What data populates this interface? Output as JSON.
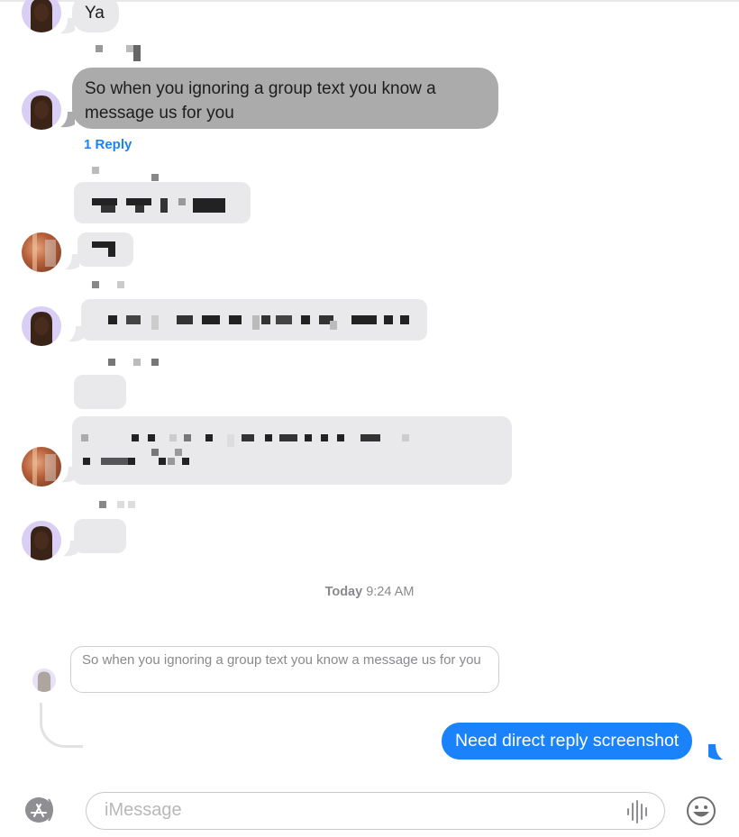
{
  "conversation": {
    "messages": [
      {
        "sender": "contact-memoji",
        "text": "Ya",
        "style": "incoming"
      },
      {
        "sender": "contact-memoji",
        "text": "So when you ignoring a group text you know a message us for you",
        "style": "incoming-selected",
        "reply_count_label": "1 Reply"
      },
      {
        "sender": "redacted",
        "text": "",
        "style": "incoming-redacted"
      },
      {
        "sender": "contact-photo",
        "text": "",
        "style": "incoming-redacted"
      },
      {
        "sender": "contact-memoji",
        "text": "",
        "style": "incoming-redacted"
      },
      {
        "sender": "redacted",
        "text": "",
        "style": "incoming-redacted"
      },
      {
        "sender": "contact-photo",
        "text": "",
        "style": "incoming-redacted"
      },
      {
        "sender": "contact-memoji",
        "text": "",
        "style": "incoming-redacted"
      }
    ],
    "timestamp": {
      "day": "Today",
      "time": "9:24 AM"
    },
    "inline_reply": {
      "quoted_text": "So when you ignoring a group text you know a message us for you",
      "reply_text": "Need direct reply screenshot"
    }
  },
  "composer": {
    "placeholder": "iMessage",
    "value": "",
    "apps_icon": "app-store-icon",
    "audio_icon": "waveform-icon",
    "emoji_icon": "smiley-icon"
  },
  "colors": {
    "accent_blue": "#1a82fb",
    "incoming_bubble": "#e9e9eb",
    "selected_bubble": "#ababab",
    "memoji_bg": "#d9cff5"
  }
}
